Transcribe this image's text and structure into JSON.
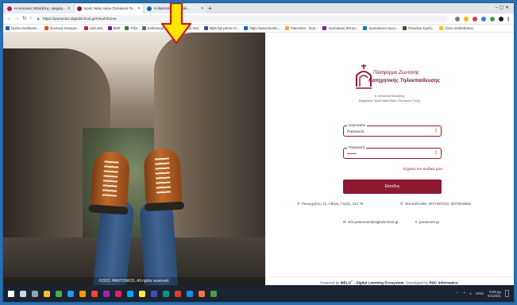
{
  "browser": {
    "tabs": [
      {
        "label": "Η Αντώνιος Μπαζάτης, εφημέρ...",
        "active": false,
        "color": "#c2185b"
      },
      {
        "label": "Ιερός Ναός Αγίου Στυλιανού Γκ...",
        "active": true,
        "color": "#8d1832"
      },
      {
        "label": "Η διαστατή... - Εμαίλ...",
        "active": false,
        "color": "#1565c0"
      }
    ],
    "new_tab": "+",
    "window_controls": "–   ▢   ✕",
    "url": "https://pantonios.digitalschool.gr/#/auth/home",
    "bookmarks": [
      "Όμιλοι ελεύθερου...",
      "Ζωντανή Καταγρα...",
      "Δίκτυακή",
      "BDR",
      "Τόξα",
      "Ενδοσκεψη",
      "Ενεργειακή Ζωή",
      "https://gr.yahoo.co...",
      "https://www.facebo...",
      "PlanetSim - Ζωή...",
      "Χριστιανική Φοιτητ...",
      "Χριστιανικοί Αγων...",
      "Πευκάκια Σχολή...",
      "Άλλοι σελιδοδείκτες"
    ],
    "bookmark_colors": [
      "#1565c0",
      "#e65100",
      "#c62828",
      "#6a1b9a",
      "#2e7d32",
      "#546e7a",
      "#00897b",
      "#3949ab",
      "#1565c0",
      "#f9a825",
      "#7b1fa2",
      "#0277bd",
      "#5d4037",
      "#fbc02d"
    ]
  },
  "page": {
    "logo": {
      "line1": "Πλατφόρμα Ζωντανής",
      "line2": "Κατηχητικής Τηλεκπαίδευσης",
      "sub1": "π. Αντώνιος Μπαζάτης",
      "sub2": "Εφημέριος Ιερού Ναού Αγίου Στυλιανού Γκύζη"
    },
    "username": {
      "label": "Username",
      "value": "Pantonios"
    },
    "password": {
      "label": "Password",
      "value": "•••••••"
    },
    "forgot": "Ξέχασα τον κωδικό μου",
    "signin": "Είσοδος",
    "address": "Πανορμήτου 12, Αθήνα, Γκύζη, 114 76",
    "phone": "210-6401469, 6977387010, 6973519591",
    "email": "info.pantonios@digitalschool.gr",
    "website": "pantonios.gr",
    "copyright": "©2021 PANTONIOS. All rights reserved.",
    "footer": {
      "prefix": "Powered by ",
      "melo": "MELO",
      "reg": "®",
      "middle": " - Digital Learning Ecosystem",
      "dev": ". Developed by ",
      "rdc": "RDC Informatics",
      "end": "."
    },
    "accent_color": "#8d1832"
  },
  "taskbar": {
    "icon_colors": [
      "#ffffff",
      "#cfd8dc",
      "#90a4ae",
      "#fbc02d",
      "#4caf50",
      "#2196f3",
      "#ff9800",
      "#f44336",
      "#9c27b0",
      "#e91e63",
      "#03a9f4",
      "#ffeb3b",
      "#3f51b5",
      "#009688",
      "#e53935",
      "#1e88e5",
      "#ff7043",
      "#43a047"
    ],
    "language": "ENG",
    "time": "9:09 μμ",
    "date": "6/1/2021"
  }
}
